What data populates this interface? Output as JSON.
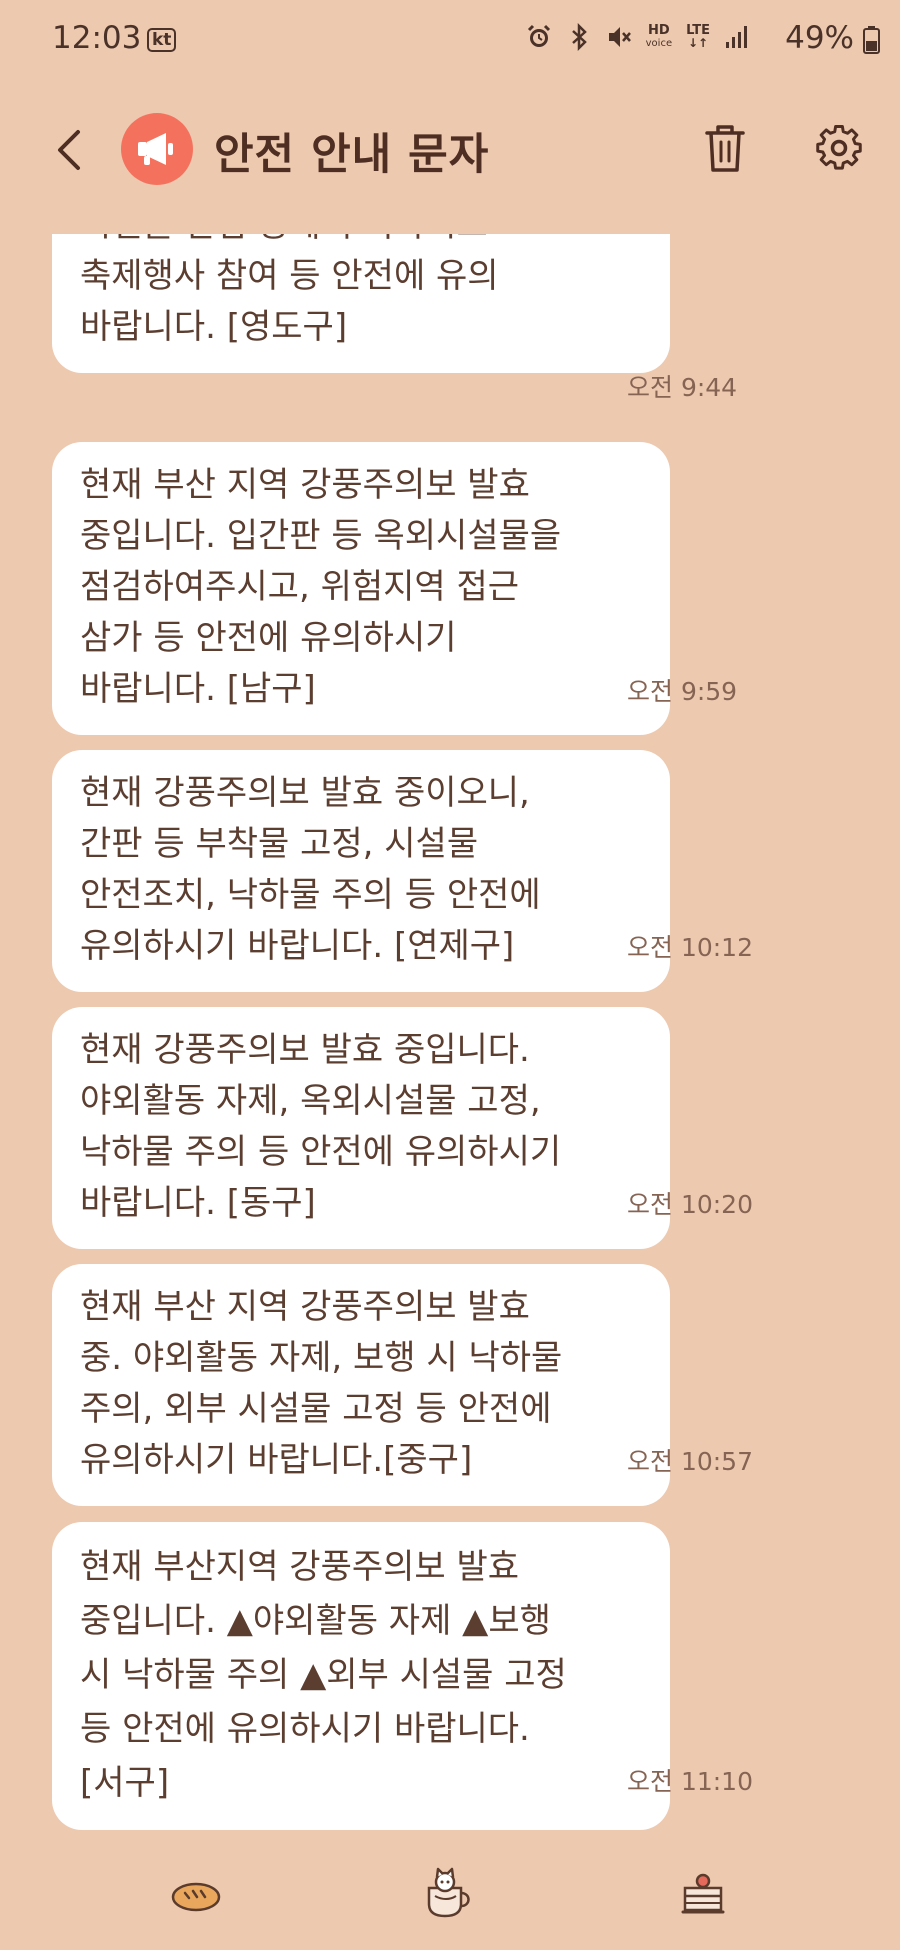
{
  "status_bar": {
    "time": "12:03",
    "carrier": "kt",
    "hd_top": "HD",
    "hd_bottom": "voice",
    "lte": "LTE",
    "battery": "49%"
  },
  "header": {
    "title": "안전 안내 문자",
    "avatar_color": "#f4725d"
  },
  "messages": [
    {
      "text": "시설물 날림 등에 주의하시고\n축제행사 참여 등 안전에 유의\n바랍니다. [영도구]",
      "time": "오전 9:44"
    },
    {
      "text": "현재 부산 지역 강풍주의보 발효\n중입니다. 입간판 등 옥외시설물을\n점검하여주시고, 위험지역 접근\n삼가 등 안전에 유의하시기\n바랍니다. [남구]",
      "time": "오전 9:59"
    },
    {
      "text": "현재 강풍주의보 발효 중이오니,\n간판 등 부착물 고정, 시설물\n안전조치, 낙하물 주의 등 안전에\n유의하시기 바랍니다. [연제구]",
      "time": "오전 10:12"
    },
    {
      "text": "현재 강풍주의보 발효 중입니다.\n야외활동 자제, 옥외시설물 고정,\n낙하물 주의 등 안전에 유의하시기\n바랍니다. [동구]",
      "time": "오전 10:20"
    },
    {
      "text": "현재 부산 지역 강풍주의보 발효\n중. 야외활동 자제, 보행 시 낙하물\n주의, 외부 시설물 고정 등 안전에\n유의하시기 바랍니다.[중구]",
      "time": "오전 10:57"
    },
    {
      "text": "현재 부산지역 강풍주의보 발효\n중입니다. ▲야외활동 자제 ▲보행\n시 낙하물 주의 ▲외부 시설물 고정\n등 안전에 유의하시기 바랍니다.\n[서구]",
      "time": "오전 11:10"
    }
  ],
  "dock": {
    "icons": [
      "bread-icon",
      "coffee-cup-cat-icon",
      "cake-icon"
    ]
  }
}
